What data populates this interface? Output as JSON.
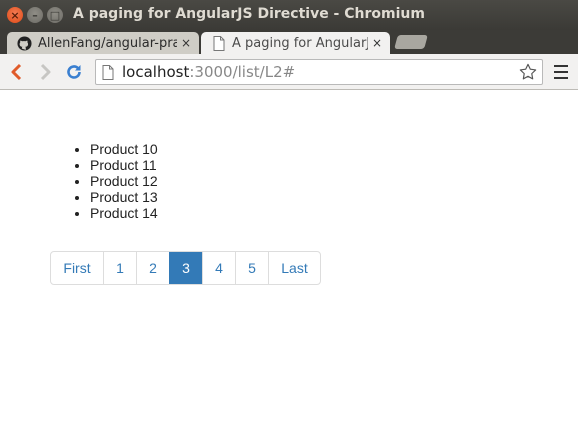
{
  "window": {
    "title": "A paging for AngularJS Directive - Chromium",
    "close_glyph": "×",
    "minimize_glyph": "–",
    "maximize_glyph": "□"
  },
  "tabs": [
    {
      "label": "AllenFang/angular-pra",
      "icon": "github-icon",
      "active": false,
      "close_glyph": "×"
    },
    {
      "label": "A paging for AngularJS",
      "icon": "page-icon",
      "active": true,
      "close_glyph": "×"
    }
  ],
  "toolbar": {
    "url_host": "localhost",
    "url_path": ":3000/list/L2#",
    "icons": [
      "back-icon",
      "forward-icon",
      "reload-icon",
      "page-icon",
      "star-icon",
      "menu-icon"
    ]
  },
  "products": [
    "Product 10",
    "Product 11",
    "Product 12",
    "Product 13",
    "Product 14"
  ],
  "pagination": {
    "items": [
      "First",
      "1",
      "2",
      "3",
      "4",
      "5",
      "Last"
    ],
    "active": "3",
    "accent_color": "#337ab7"
  }
}
